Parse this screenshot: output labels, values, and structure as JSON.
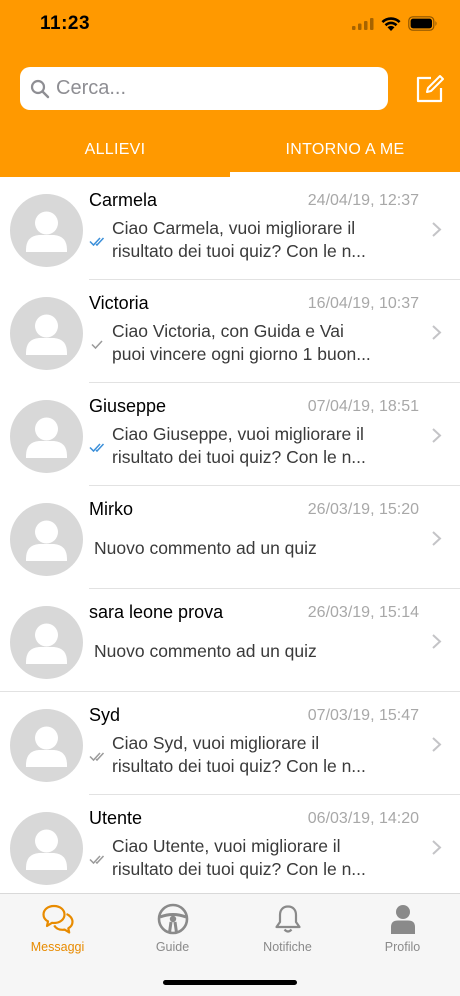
{
  "status": {
    "time": "11:23"
  },
  "search": {
    "placeholder": "Cerca..."
  },
  "tabs": [
    {
      "label": "ALLIEVI",
      "selected": false
    },
    {
      "label": "INTORNO A ME",
      "selected": true
    }
  ],
  "conversations": [
    {
      "name": "Carmela",
      "date": "24/04/19, 12:37",
      "tick": "double-check-blue",
      "lines": [
        "Ciao Carmela, vuoi migliorare il",
        "risultato dei tuoi quiz? Con le n..."
      ]
    },
    {
      "name": "Victoria",
      "date": "16/04/19, 10:37",
      "tick": "single-check-gray",
      "lines": [
        "Ciao Victoria, con Guida e Vai",
        "puoi vincere ogni giorno 1 buon..."
      ]
    },
    {
      "name": "Giuseppe",
      "date": "07/04/19, 18:51",
      "tick": "double-check-blue",
      "lines": [
        "Ciao Giuseppe, vuoi migliorare il",
        "risultato dei tuoi quiz? Con le n..."
      ]
    },
    {
      "name": "Mirko",
      "date": "26/03/19, 15:20",
      "tick": "",
      "lines": [
        "Nuovo commento ad un quiz"
      ]
    },
    {
      "name": "sara leone prova",
      "date": "26/03/19, 15:14",
      "tick": "",
      "lines": [
        "Nuovo commento ad un quiz"
      ]
    },
    {
      "name": "Syd",
      "date": "07/03/19, 15:47",
      "tick": "double-check-gray",
      "lines": [
        "Ciao Syd, vuoi migliorare il",
        "risultato dei tuoi quiz? Con le n..."
      ]
    },
    {
      "name": "Utente",
      "date": "06/03/19, 14:20",
      "tick": "double-check-gray",
      "lines": [
        "Ciao Utente, vuoi migliorare il",
        "risultato dei tuoi quiz? Con le n..."
      ]
    }
  ],
  "tabbar": [
    {
      "label": "Messaggi",
      "icon": "chat-bubbles-icon",
      "active": true
    },
    {
      "label": "Guide",
      "icon": "steering-wheel-icon",
      "active": false
    },
    {
      "label": "Notifiche",
      "icon": "bell-icon",
      "active": false
    },
    {
      "label": "Profilo",
      "icon": "person-icon",
      "active": false
    }
  ],
  "colors": {
    "accent": "#ff9900",
    "tab_active": "#e88b00",
    "read_tick": "#3b8fd9",
    "muted": "#a8a8a8"
  }
}
